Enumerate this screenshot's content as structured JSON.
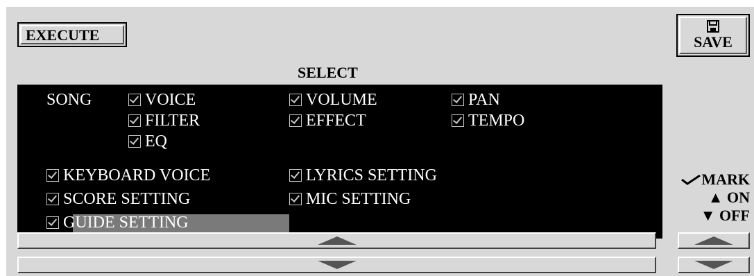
{
  "toolbar": {
    "execute_label": "EXECUTE",
    "save_label": "SAVE"
  },
  "select_title": "SELECT",
  "song": {
    "label": "SONG",
    "items": [
      {
        "label": "VOICE",
        "checked": true
      },
      {
        "label": "VOLUME",
        "checked": true
      },
      {
        "label": "PAN",
        "checked": true
      },
      {
        "label": "FILTER",
        "checked": true
      },
      {
        "label": "EFFECT",
        "checked": true
      },
      {
        "label": "TEMPO",
        "checked": true
      },
      {
        "label": "EQ",
        "checked": true
      }
    ]
  },
  "other": {
    "items": [
      {
        "label": "KEYBOARD VOICE",
        "checked": true
      },
      {
        "label": "LYRICS SETTING",
        "checked": true
      },
      {
        "label": "SCORE SETTING",
        "checked": true
      },
      {
        "label": "MIC SETTING",
        "checked": true
      },
      {
        "label": "GUIDE SETTING",
        "checked": true,
        "selected": true
      }
    ]
  },
  "legend": {
    "mark": "MARK",
    "on": "ON",
    "off": "OFF"
  },
  "icons": {
    "save": "floppy-disk-icon",
    "mark": "checkmark-icon",
    "on": "triangle-up-icon",
    "off": "triangle-down-icon",
    "scroll_up": "chevron-up-icon",
    "scroll_down": "chevron-down-icon"
  }
}
